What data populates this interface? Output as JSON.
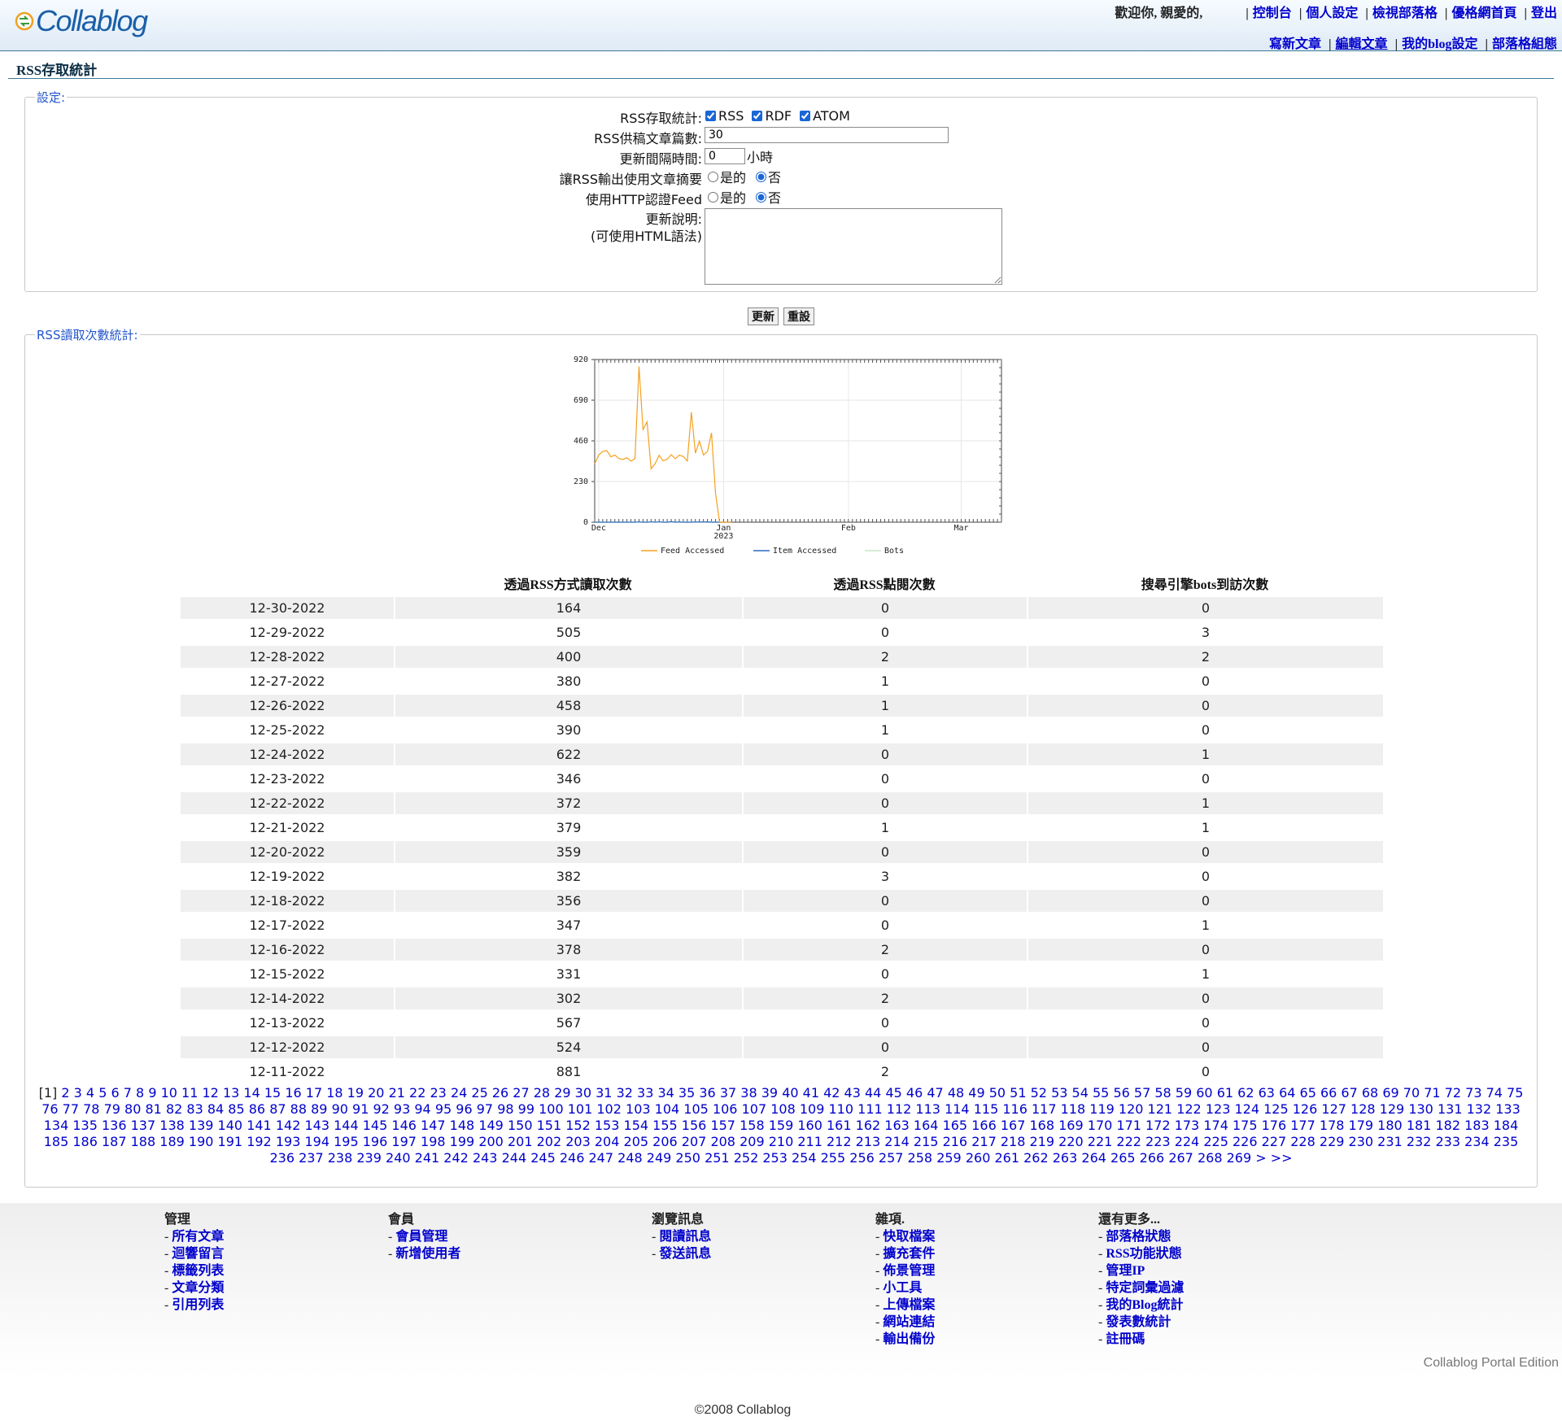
{
  "header": {
    "logo_text": "Collablog",
    "welcome": "歡迎你, 親愛的,",
    "links": [
      "控制台",
      "個人設定",
      "檢視部落格",
      "優格網首頁",
      "登出"
    ],
    "links2": [
      "寫新文章",
      "編輯文章",
      "我的blog設定",
      "部落格組態"
    ]
  },
  "page": {
    "title": "RSS存取統計"
  },
  "settings": {
    "legend": "設定:",
    "rss_stats_label": "RSS存取統計:",
    "feeds": [
      {
        "label": "RSS",
        "checked": true
      },
      {
        "label": "RDF",
        "checked": true
      },
      {
        "label": "ATOM",
        "checked": true
      }
    ],
    "article_count_label": "RSS供稿文章篇數:",
    "article_count_value": "30",
    "interval_label": "更新間隔時間:",
    "interval_value": "0",
    "interval_unit": "小時",
    "summary_label": "讓RSS輸出使用文章摘要",
    "http_auth_label": "使用HTTP認證Feed",
    "yes_label": "是的",
    "no_label": "否",
    "summary_selected": "no",
    "http_auth_selected": "no",
    "desc_label": "更新說明:",
    "desc_hint": "(可使用HTML語法)",
    "desc_value": "",
    "update_button": "更新",
    "reset_button": "重設"
  },
  "stats": {
    "legend": "RSS讀取次數統計:",
    "columns": [
      "",
      "透過RSS方式讀取次數",
      "透過RSS點閱次數",
      "搜尋引擎bots到訪次數"
    ],
    "rows": [
      [
        "12-30-2022",
        "164",
        "0",
        "0"
      ],
      [
        "12-29-2022",
        "505",
        "0",
        "3"
      ],
      [
        "12-28-2022",
        "400",
        "2",
        "2"
      ],
      [
        "12-27-2022",
        "380",
        "1",
        "0"
      ],
      [
        "12-26-2022",
        "458",
        "1",
        "0"
      ],
      [
        "12-25-2022",
        "390",
        "1",
        "0"
      ],
      [
        "12-24-2022",
        "622",
        "0",
        "1"
      ],
      [
        "12-23-2022",
        "346",
        "0",
        "0"
      ],
      [
        "12-22-2022",
        "372",
        "0",
        "1"
      ],
      [
        "12-21-2022",
        "379",
        "1",
        "1"
      ],
      [
        "12-20-2022",
        "359",
        "0",
        "0"
      ],
      [
        "12-19-2022",
        "382",
        "3",
        "0"
      ],
      [
        "12-18-2022",
        "356",
        "0",
        "0"
      ],
      [
        "12-17-2022",
        "347",
        "0",
        "1"
      ],
      [
        "12-16-2022",
        "378",
        "2",
        "0"
      ],
      [
        "12-15-2022",
        "331",
        "0",
        "1"
      ],
      [
        "12-14-2022",
        "302",
        "2",
        "0"
      ],
      [
        "12-13-2022",
        "567",
        "0",
        "0"
      ],
      [
        "12-12-2022",
        "524",
        "0",
        "0"
      ],
      [
        "12-11-2022",
        "881",
        "2",
        "0"
      ]
    ],
    "pager": {
      "current": "[1]",
      "first_link": 2,
      "last_page": 269,
      "next": ">",
      "last": ">>"
    }
  },
  "chart_data": {
    "type": "line",
    "title": "",
    "xlabel": "",
    "ylabel": "",
    "ylim": [
      0,
      920
    ],
    "yticks": [
      0,
      230,
      460,
      690,
      920
    ],
    "x_ticks": [
      {
        "label": "Dec",
        "day": 2
      },
      {
        "label": "Jan",
        "sublabel": "2023",
        "day": 33
      },
      {
        "label": "Feb",
        "day": 64
      },
      {
        "label": "Mar",
        "day": 92
      }
    ],
    "x_range": [
      1,
      102
    ],
    "x_units": "days since 2022-11-30",
    "series": [
      {
        "name": "Feed Accessed",
        "color": "#f5a020",
        "x": [
          1,
          2,
          3,
          4,
          5,
          6,
          7,
          8,
          9,
          10,
          11,
          12,
          13,
          14,
          15,
          16,
          17,
          18,
          19,
          20,
          21,
          22,
          23,
          24,
          25,
          26,
          27,
          28,
          29,
          30,
          31,
          32,
          33,
          34,
          35
        ],
        "values": [
          330,
          380,
          400,
          405,
          370,
          380,
          360,
          355,
          365,
          345,
          360,
          881,
          524,
          567,
          302,
          331,
          378,
          347,
          356,
          382,
          359,
          379,
          372,
          346,
          622,
          390,
          458,
          380,
          400,
          505,
          164,
          0,
          0,
          0,
          0
        ]
      },
      {
        "name": "Item Accessed",
        "color": "#2a6cc2",
        "x": [
          1,
          2,
          3,
          4,
          5,
          6,
          7,
          8,
          9,
          10,
          11,
          12,
          13,
          14,
          15,
          16,
          17,
          18,
          19,
          20,
          21,
          22,
          23,
          24,
          25,
          26,
          27,
          28,
          29,
          30,
          31,
          32,
          33,
          34,
          35
        ],
        "values": [
          0,
          0,
          0,
          0,
          0,
          0,
          0,
          0,
          0,
          0,
          0,
          2,
          0,
          0,
          2,
          0,
          2,
          0,
          0,
          3,
          0,
          1,
          0,
          0,
          0,
          1,
          1,
          1,
          2,
          0,
          0,
          0,
          0,
          0,
          0
        ]
      },
      {
        "name": "Bots",
        "color": "#c9e6c9",
        "x": [
          1,
          2,
          3,
          4,
          5,
          6,
          7,
          8,
          9,
          10,
          11,
          12,
          13,
          14,
          15,
          16,
          17,
          18,
          19,
          20,
          21,
          22,
          23,
          24,
          25,
          26,
          27,
          28,
          29,
          30,
          31,
          32,
          33,
          34,
          35
        ],
        "values": [
          0,
          0,
          0,
          0,
          0,
          0,
          0,
          0,
          0,
          0,
          0,
          0,
          0,
          0,
          0,
          1,
          0,
          1,
          0,
          0,
          0,
          1,
          1,
          0,
          1,
          0,
          0,
          0,
          2,
          3,
          0,
          0,
          0,
          0,
          0
        ]
      }
    ],
    "legend": [
      "Feed Accessed",
      "Item Accessed",
      "Bots"
    ],
    "legend_position": "bottom",
    "grid": true
  },
  "footer": {
    "columns": [
      {
        "title": "管理",
        "items": [
          "所有文章",
          "迴響留言",
          "標籤列表",
          "文章分類",
          "引用列表"
        ]
      },
      {
        "title": "會員",
        "items": [
          "會員管理",
          "新增使用者"
        ]
      },
      {
        "title": "瀏覽訊息",
        "items": [
          "閱讀訊息",
          "發送訊息"
        ]
      },
      {
        "title": "雜項.",
        "items": [
          "快取檔案",
          "擴充套件",
          "佈景管理",
          "小工具",
          "上傳檔案",
          "網站連結",
          "輸出備份"
        ]
      },
      {
        "title": "還有更多...",
        "items": [
          "部落格狀態",
          "RSS功能狀態",
          "管理IP",
          "特定詞彙過濾",
          "我的Blog統計",
          "發表數統計",
          "註冊碼"
        ]
      }
    ],
    "edition": "Collablog Portal Edition",
    "copyright": "©2008 Collablog"
  }
}
